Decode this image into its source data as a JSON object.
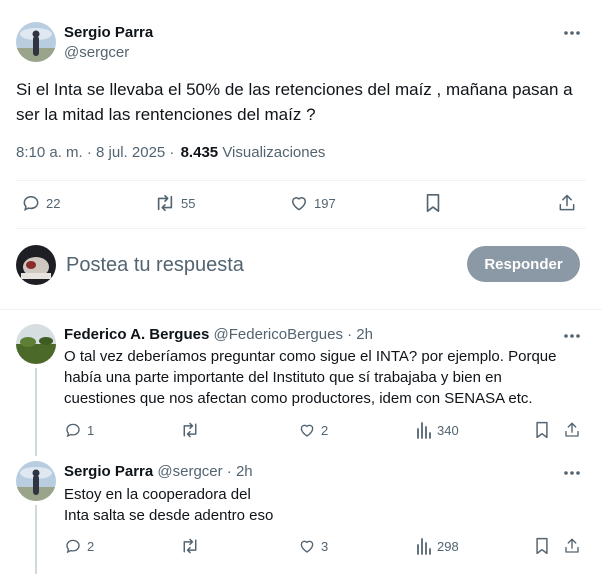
{
  "main_post": {
    "author_name": "Sergio Parra",
    "author_handle": "@sergcer",
    "text_line1": "Si el Inta se llevaba el 50% de las retenciones del maíz , mañana pasan a",
    "text_line2": "ser la mitad las rentenciones del maíz ?",
    "time": "8:10 a. m. · 8 jul. 2025 ·",
    "views_count": "8.435",
    "views_label": "Visualizaciones",
    "replies": "22",
    "reposts": "55",
    "likes": "197"
  },
  "composer": {
    "placeholder": "Postea tu respuesta",
    "reply_button": "Responder"
  },
  "replies": [
    {
      "author_name": "Federico A. Bergues",
      "meta": "@FedericoBergues · 2h",
      "line1": "O tal vez deberíamos preguntar como sigue el INTA? por ejemplo. Porque",
      "line2": "había una parte importante del Instituto que sí trabajaba y bien en",
      "line3": "cuestiones que nos afectan como productores, idem con SENASA etc.",
      "replies": "1",
      "reposts": "",
      "likes": "2",
      "views": "340"
    },
    {
      "author_name": "Sergio Parra",
      "meta": "@sergcer · 2h",
      "line1": "Estoy en la cooperadora del",
      "line2": "Inta salta se desde adentro eso",
      "replies": "2",
      "reposts": "",
      "likes": "3",
      "views": "298"
    }
  ],
  "colors": {
    "text": "#0f1419",
    "muted": "#536471",
    "button_disabled": "#8b98a5",
    "divider": "#eff3f4"
  }
}
